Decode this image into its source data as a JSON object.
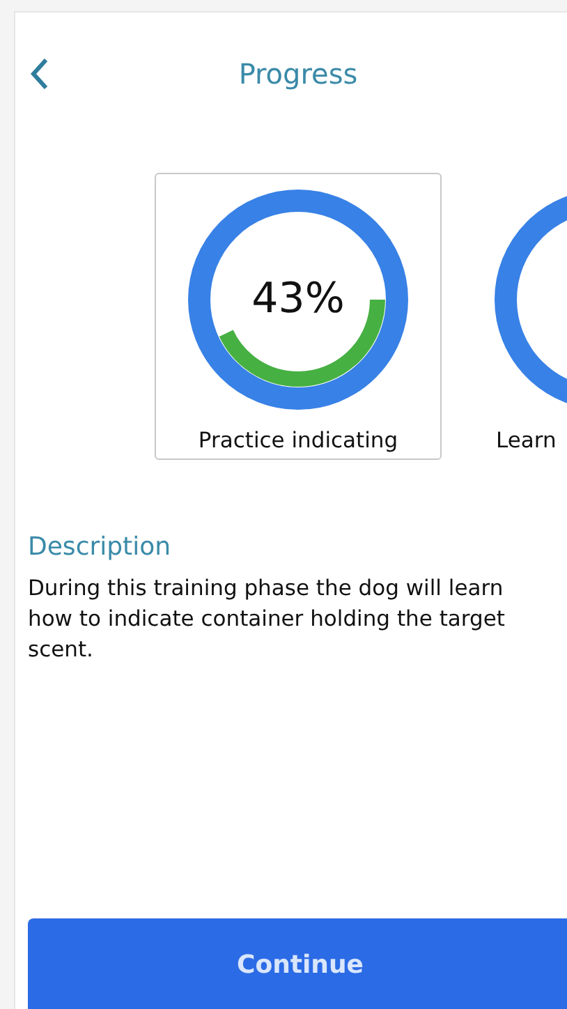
{
  "header": {
    "title": "Progress"
  },
  "phases": [
    {
      "label": "Practice indicating",
      "percent": "43%",
      "level": 0.43,
      "selected": true
    },
    {
      "label": "Learn",
      "selected": false
    }
  ],
  "description": {
    "heading": "Description",
    "text": "During this training phase the dog will learn how to indicate container holding the target scent."
  },
  "button": {
    "label": "Continue"
  }
}
